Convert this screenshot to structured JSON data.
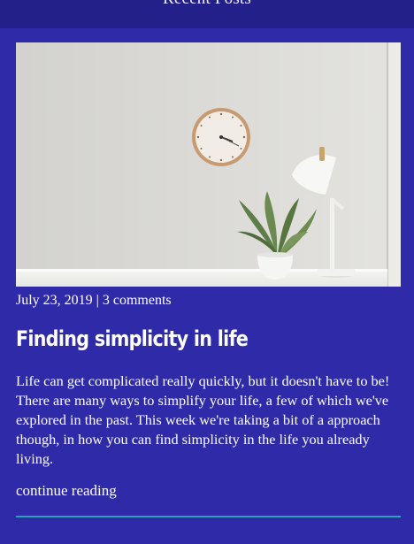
{
  "header": {
    "section_title": "Recent Posts"
  },
  "post": {
    "image_alt": "White desk with wall clock, small potted plant and desk lamp",
    "date": "July 23, 2019",
    "separator": "|",
    "comments": "3 comments",
    "title": "Finding simplicity in life",
    "excerpt": "Life can get complicated really quickly, but it doesn't have to be! There are many ways to simplify your life, a few of which we've explored in the past. This week we're taking a bit of a approach though, in how you can find simplicity in the life you already living.",
    "continue_label": "continue reading"
  },
  "colors": {
    "background": "#2f2ba8",
    "header_bar": "#24208a",
    "divider": "#2aa3b8",
    "text": "#ffffff"
  }
}
